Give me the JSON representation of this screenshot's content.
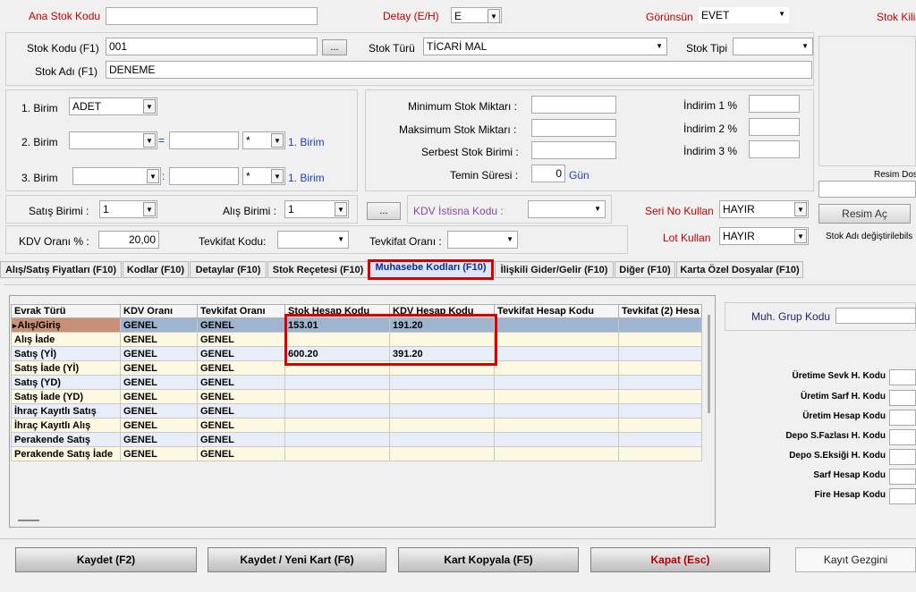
{
  "header": {
    "ana_stok_kodu_label": "Ana Stok Kodu",
    "detay_label": "Detay (E/H)",
    "detay_value": "E",
    "gorunsun_label": "Görünsün",
    "gorunsun_value": "EVET",
    "stok_kilit_label": "Stok Kili"
  },
  "stok": {
    "kodu_label": "Stok Kodu (F1)",
    "kodu_value": "001",
    "browse_label": "...",
    "turu_label": "Stok Türü",
    "turu_value": "TİCARİ MAL",
    "tipi_label": "Stok Tipi",
    "adi_label": "Stok Adı (F1)",
    "adi_value": "DENEME"
  },
  "birim": {
    "birim1_label": "1. Birim",
    "birim1_value": "ADET",
    "birim2_label": "2. Birim",
    "birim3_label": "3. Birim",
    "eq": "=",
    "colon": ":",
    "op": "*",
    "ref1": "1. Birim",
    "ref2": "1. Birim"
  },
  "miktar": {
    "min_label": "Minimum Stok Miktarı :",
    "max_label": "Maksimum Stok Miktarı :",
    "serbest_label": "Serbest Stok Birimi :",
    "temin_label": "Temin Süresi :",
    "temin_value": "0",
    "gun_label": "Gün"
  },
  "indirim": {
    "ind1_label": "İndirim 1 %",
    "ind2_label": "İndirim 2 %",
    "ind3_label": "İndirim 3 %"
  },
  "satis_alis": {
    "satis_label": "Satış Birimi :",
    "satis_value": "1",
    "alis_label": "Alış Birimi :",
    "alis_value": "1",
    "dots": "...",
    "kdv_istisna_label": "KDV İstisna Kodu :",
    "seri_no_label": "Seri No Kullan",
    "seri_no_value": "HAYIR",
    "lot_label": "Lot Kullan",
    "lot_value": "HAYIR",
    "kdv_orani_label": "KDV Oranı % :",
    "kdv_orani_value": "20,00",
    "tevkifat_kodu_label": "Tevkifat Kodu:",
    "tevkifat_orani_label": "Tevkifat Oranı :"
  },
  "resim": {
    "dosya_label": "Resim Dos",
    "ac_label": "Resim Aç",
    "note": "Stok Adı değiştirilebils"
  },
  "tabs": [
    "Alış/Satış Fiyatları (F10)",
    "Kodlar (F10)",
    "Detaylar (F10)",
    "Stok Reçetesi (F10)",
    "Muhasebe Kodları (F10)",
    "İlişkili Gider/Gelir (F10)",
    "Diğer (F10)",
    "Karta Özel Dosyalar (F10)"
  ],
  "grid": {
    "columns": [
      "Evrak Türü",
      "KDV Oranı",
      "Tevkifat Oranı",
      "Stok Hesap Kodu",
      "KDV Hesap Kodu",
      "Tevkifat Hesap Kodu",
      "Tevkifat (2) Hesa"
    ],
    "rows": [
      [
        "Alış/Giriş",
        "GENEL",
        "GENEL",
        "153.01",
        "191.20",
        "",
        ""
      ],
      [
        "Alış İade",
        "GENEL",
        "GENEL",
        "",
        "",
        "",
        ""
      ],
      [
        "Satış (Yİ)",
        "GENEL",
        "GENEL",
        "600.20",
        "391.20",
        "",
        ""
      ],
      [
        "Satış İade (Yİ)",
        "GENEL",
        "GENEL",
        "",
        "",
        "",
        ""
      ],
      [
        "Satış (YD)",
        "GENEL",
        "GENEL",
        "",
        "",
        "",
        ""
      ],
      [
        "Satış İade (YD)",
        "GENEL",
        "GENEL",
        "",
        "",
        "",
        ""
      ],
      [
        "İhraç Kayıtlı Satış",
        "GENEL",
        "GENEL",
        "",
        "",
        "",
        ""
      ],
      [
        "İhraç Kayıtlı Alış",
        "GENEL",
        "GENEL",
        "",
        "",
        "",
        ""
      ],
      [
        "Perakende Satış",
        "GENEL",
        "GENEL",
        "",
        "",
        "",
        ""
      ],
      [
        "Perakende Satış İade",
        "GENEL",
        "GENEL",
        "",
        "",
        "",
        ""
      ]
    ]
  },
  "right_panel": {
    "muh_grup_label": "Muh. Grup Kodu",
    "fields": [
      "Üretime Sevk H. Kodu",
      "Üretim Sarf H. Kodu",
      "Üretim Hesap Kodu",
      "Depo S.Fazlası H. Kodu",
      "Depo S.Eksiği H. Kodu",
      "Sarf Hesap Kodu",
      "Fire Hesap Kodu"
    ]
  },
  "buttons": {
    "kaydet": "Kaydet (F2)",
    "kaydet_yeni": "Kaydet / Yeni Kart (F6)",
    "kopyala": "Kart Kopyala (F5)",
    "kapat": "Kapat (Esc)",
    "gezgini": "Kayıt Gezgini"
  },
  "colors": {
    "label_red": "#c00000",
    "label_blue": "#1f3fbf",
    "highlight_red": "#d90000",
    "selected_row": "#9fb4cf"
  }
}
